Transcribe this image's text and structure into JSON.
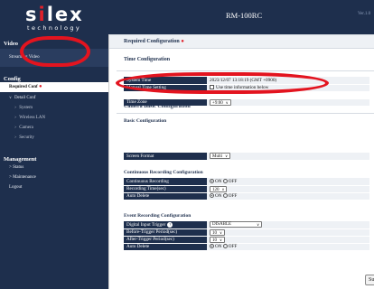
{
  "header": {
    "logo_pre": "s",
    "logo_x": "i",
    "logo_post": "lex",
    "logo_tagline": "technology",
    "model": "RM-100RC",
    "version": "Ver.1.0"
  },
  "sidebar": {
    "video_heading": "Video",
    "streaming_video": "Streaming Video",
    "config_heading": "Config",
    "required_conf": "Required Conf",
    "detail_conf": "Detail Conf",
    "detail_items": [
      "System",
      "Wireless LAN",
      "Camera",
      "Security"
    ],
    "management_heading": "Management",
    "management_items": [
      "Status",
      "Maintenance",
      "Logout"
    ]
  },
  "main": {
    "page_title": "Required Configuration",
    "time_section": {
      "title": "Time Configuration",
      "system_time_label": "System Time",
      "system_time_value": "2023/12/07 13:18:19 (GMT +0900)",
      "manual_label": "Manual Time Setting",
      "use_time_info": "Use time information below",
      "timezone_label": "Time Zone",
      "timezone_value": "+9:00"
    },
    "camera_section": {
      "title": "Camera Basic Configuration",
      "basic": {
        "title": "Basic Configuration",
        "screen_format_label": "Screen Format",
        "screen_format_value": "Multi"
      },
      "continuous": {
        "title": "Continuous Recording Configuration",
        "rec_label": "Continuous Recording",
        "rec_on": "ON",
        "rec_off": "OFF",
        "time_label": "Recording Time(sec)",
        "time_value": "120",
        "autodel_label": "Auto Delete",
        "autodel_on": "ON",
        "autodel_off": "OFF"
      },
      "event": {
        "title": "Event Recording Configuration",
        "dit_label": "Digital Input Trigger",
        "dit_value": "DISABLE",
        "before_label": "Before-Trigger Period(sec)",
        "before_value": "10",
        "after_label": "After-Trigger Period(sec)",
        "after_value": "10",
        "autodel_label": "Auto Delete",
        "autodel_on": "ON",
        "autodel_off": "OFF"
      }
    },
    "submit_label": "Submit"
  },
  "icons": {
    "help": "question-mark-circle",
    "required": "red-dot",
    "chevron": "chevron-down"
  },
  "colors": {
    "navy": "#1e2f4d",
    "annotation_red": "#e3141f"
  }
}
